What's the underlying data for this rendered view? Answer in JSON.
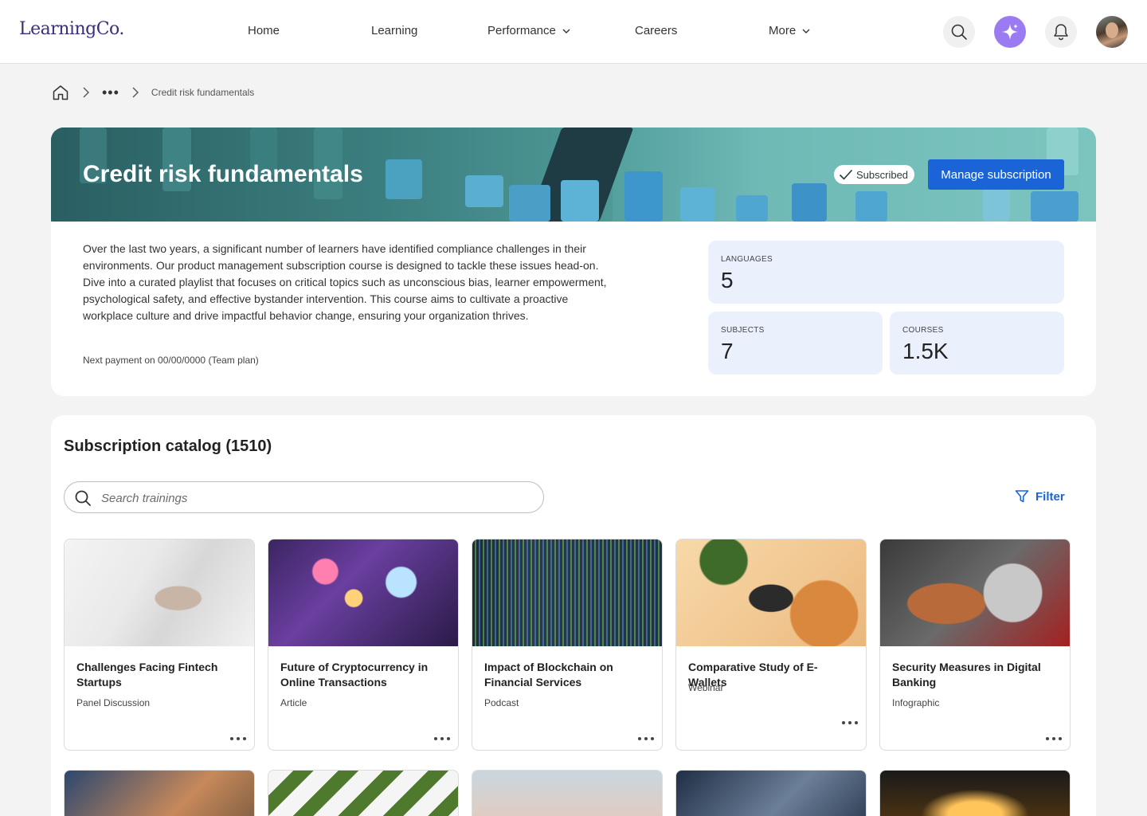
{
  "nav": {
    "logo": "LearningCo.",
    "items": [
      {
        "label": "Home"
      },
      {
        "label": "Learning"
      },
      {
        "label": "Performance"
      },
      {
        "label": "Careers"
      },
      {
        "label": "More"
      }
    ],
    "icons": [
      "search-icon",
      "sparkle-icon",
      "bell-icon",
      "avatar"
    ]
  },
  "breadcrumb": {
    "more": "•••",
    "current": "Credit risk fundamentals"
  },
  "hero": {
    "title": "Credit risk fundamentals",
    "subscribed_label": "Subscribed",
    "manage_label": "Manage subscription",
    "description": "Over the last two years, a significant number of learners have identified compliance challenges in their environments. Our product management subscription course is designed to tackle these issues head-on. Dive into a curated playlist that focuses on critical topics such as unconscious bias, learner empowerment, psychological safety, and effective bystander intervention. This course aims to cultivate a proactive workplace culture and drive impactful behavior change, ensuring your organization thrives.",
    "next_payment": "Next payment on 00/00/0000 (Team plan)",
    "stats": {
      "languages": {
        "label": "LANGUAGES",
        "value": "5"
      },
      "subjects": {
        "label": "SUBJECTS",
        "value": "7"
      },
      "courses": {
        "label": "COURSES",
        "value": "1.5K"
      }
    }
  },
  "catalog": {
    "title": "Subscription catalog (1510)",
    "search_placeholder": "Search trainings",
    "filter_label": "Filter",
    "cards": [
      {
        "title": "Challenges Facing Fintech Startups",
        "type": "Panel Discussion"
      },
      {
        "title": "Future of Cryptocurrency in Online Transactions",
        "type": "Article"
      },
      {
        "title": "Impact of Blockchain on Financial Services",
        "type": "Podcast"
      },
      {
        "title": "Comparative Study of E-Wallets",
        "type": "Webinar"
      },
      {
        "title": "Security Measures in Digital Banking",
        "type": "Infographic"
      }
    ]
  },
  "colors": {
    "accent": "#1a64d8",
    "ai_button": "#9a7bf2",
    "stat_bg": "#eaf1fd",
    "logo": "#3b2f7a"
  }
}
